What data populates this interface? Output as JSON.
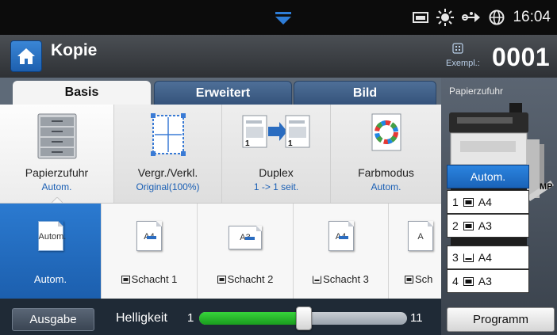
{
  "status": {
    "time": "16:04",
    "icons": [
      "tray-status-icon",
      "toner-sun-icon",
      "network-icon",
      "globe-icon"
    ]
  },
  "header": {
    "title": "Kopie",
    "copies_label": "Exempl.:",
    "copies_value": "0001"
  },
  "tabs": [
    {
      "label": "Basis",
      "active": true
    },
    {
      "label": "Erweitert",
      "active": false
    },
    {
      "label": "Bild",
      "active": false
    }
  ],
  "functions": [
    {
      "label": "Papierzufuhr",
      "value": "Autom.",
      "icon": "paper-tray-icon"
    },
    {
      "label": "Vergr./Verkl.",
      "value": "Original(100%)",
      "icon": "resize-icon"
    },
    {
      "label": "Duplex",
      "value": "1 -> 1 seit.",
      "icon": "duplex-icon"
    },
    {
      "label": "Farbmodus",
      "value": "Autom.",
      "icon": "color-wheel-icon"
    }
  ],
  "trays": [
    {
      "label": "Autom.",
      "doc": "Autom.",
      "selected": true
    },
    {
      "label": "Schacht 1",
      "doc": "A4",
      "selected": false
    },
    {
      "label": "Schacht 2",
      "doc": "A3",
      "selected": false
    },
    {
      "label": "Schacht 3",
      "doc": "A4",
      "selected": false
    },
    {
      "label": "Sch",
      "doc": "A",
      "selected": false
    }
  ],
  "bottom": {
    "output_label": "Ausgabe",
    "brightness_label": "Helligkeit",
    "brightness_min": "1",
    "brightness_max": "11",
    "brightness_level_fraction": 0.5
  },
  "right_panel": {
    "title": "Papierzufuhr",
    "mp_label": "MP",
    "tray_list": [
      {
        "label": "Autom.",
        "selected": true
      },
      {
        "number": "1",
        "size": "A4",
        "selected": false
      },
      {
        "number": "2",
        "size": "A3",
        "selected": false
      },
      {
        "number": "3",
        "size": "A4",
        "selected": false
      },
      {
        "number": "4",
        "size": "A3",
        "selected": false
      }
    ],
    "program_label": "Programm"
  },
  "colors": {
    "accent_blue": "#1d5fae",
    "slider_green": "#1a9c1e",
    "value_blue": "#1a5fb4"
  }
}
